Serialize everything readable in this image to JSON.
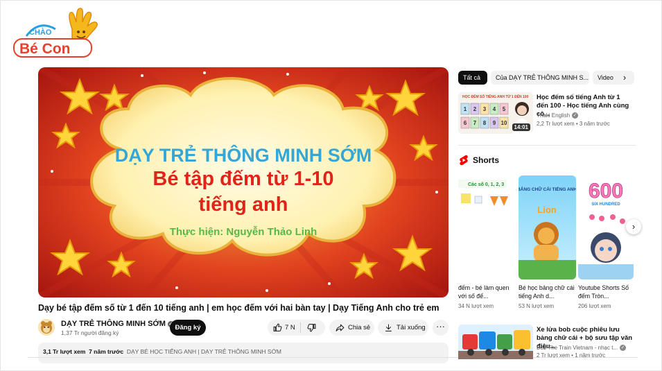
{
  "logo": {
    "text_top": "CHÀO",
    "text_bottom": "Bé Con"
  },
  "player": {
    "line1": "DẠY TRẺ THÔNG MINH SỚM",
    "line2": "Bé tập đếm từ 1-10",
    "line3": "tiếng anh",
    "line4": "Thực hiện: Nguyễn Thảo Linh"
  },
  "video": {
    "title": "Dạy bé tập đếm số từ 1 đến 10 tiếng anh | em học đếm với hai bàn tay | Dạy Tiếng Anh cho trẻ em",
    "channel": "DẠY TRẺ THÔNG MINH SỚM",
    "subscribers": "1,37 Tr người đăng ký",
    "subscribe_label": "Đăng ký",
    "likes": "7 N",
    "share_label": "Chia sẻ",
    "download_label": "Tải xuống",
    "more_label": "···"
  },
  "description": {
    "views": "3,1 Tr lượt xem",
    "age": "7 năm trước",
    "playlist": "DẠY BÉ HỌC TIẾNG ANH | DẠY TRẺ THÔNG MINH SỚM"
  },
  "chips": [
    "Tất cả",
    "Của DẠY TRẺ THÔNG MINH S...",
    "Video"
  ],
  "rec1": {
    "title": "Học đếm số tiếng Anh từ 1 đến 100 - Học tiếng Anh cùng cô...",
    "channel": "Thaki English",
    "views": "2,2 Tr lượt xem",
    "age": "3 năm trước",
    "duration": "14:01",
    "thumb_heading": "HỌC ĐẾM SỐ TIẾNG ANH TỪ 1 ĐẾN 100",
    "thumb_numbers": [
      "1",
      "2",
      "3",
      "4",
      "5",
      "6",
      "7",
      "8",
      "9",
      "10"
    ]
  },
  "shorts": {
    "heading": "Shorts",
    "items": [
      {
        "name": "đếm - bé làm quen với số đế...",
        "views": "34 N lượt xem",
        "thumb_text": "Các số 0, 1, 2, 3"
      },
      {
        "name": "Bé học bảng chữ cái tiếng Anh d...",
        "views": "53 N lượt xem",
        "thumb_text": "BẢNG CHỮ CÁI TIẾNG ANH",
        "thumb_text2": "Lion"
      },
      {
        "name": "Youtube Shorts Số đếm Tròn...",
        "views": "206 lượt xem",
        "thumb_text": "600",
        "thumb_text2": "SIX HUNDRED"
      }
    ]
  },
  "rec2": {
    "title": "Xe lửa bob cuộc phiêu lưu bảng chữ cái + bộ sưu tập văn điệu...",
    "channel": "Bob The Train Vietnam - nhạc t...",
    "views": "2 Tr lượt xem",
    "age": "1 năm trước"
  },
  "colors": {
    "title_blue": "#35a7d6",
    "title_red": "#e2231a",
    "credit_green": "#58b847",
    "shorts_red": "#ff0000"
  }
}
